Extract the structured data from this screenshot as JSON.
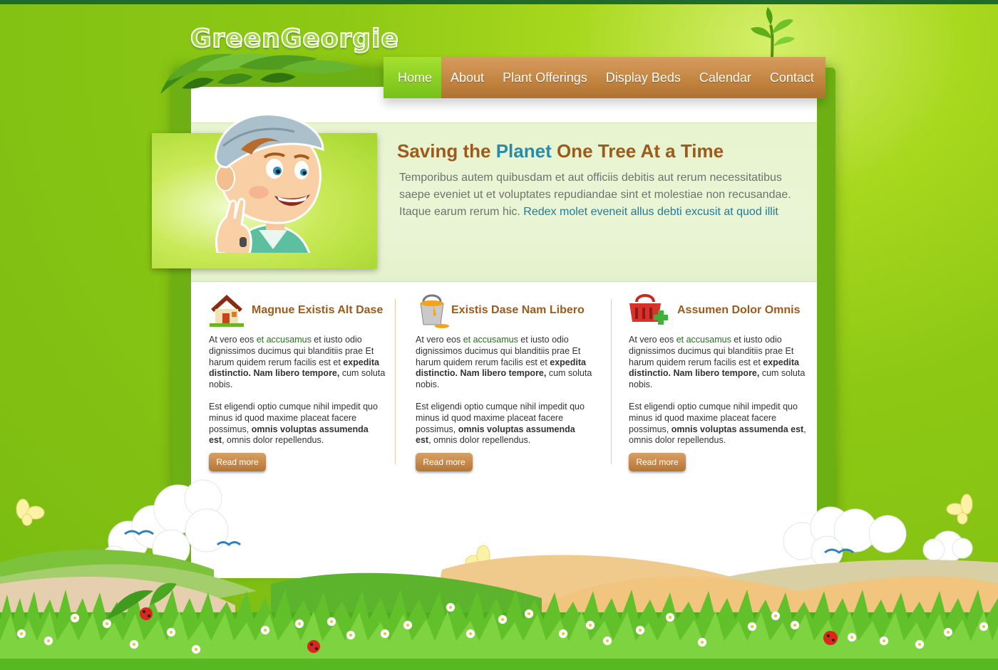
{
  "brand": {
    "logo_text": "GreenGeorgie"
  },
  "nav": {
    "items": [
      {
        "label": "Home",
        "active": true
      },
      {
        "label": "About",
        "active": false
      },
      {
        "label": "Plant Offerings",
        "active": false
      },
      {
        "label": "Display Beds",
        "active": false
      },
      {
        "label": "Calendar",
        "active": false
      },
      {
        "label": "Contact",
        "active": false
      }
    ]
  },
  "hero": {
    "title_pre": "Saving the ",
    "title_highlight": "Planet",
    "title_post": " One Tree At a Time",
    "text": "Temporibus autem quibusdam et aut officiis debitis aut rerum necessitatibus saepe eveniet ut et voluptates repudiandae sint et molestiae non recusandae. Itaque earum rerum hic. ",
    "link_text": "Redex molet eveneit allus debti excusit at quod illit"
  },
  "columns": [
    {
      "title": "Magnue Existis Alt Dase",
      "icon": "house-icon",
      "p1_a": "At vero eos ",
      "p1_link": "et accusamus",
      "p1_b": " et iusto odio dignissimos ducimus qui blanditiis prae Et harum quidem rerum facilis est et ",
      "p1_bold": "expedita distinctio. Nam libero tempore,",
      "p1_c": " cum soluta nobis.",
      "p2_a": "Est eligendi optio cumque nihil impedit quo minus id quod maxime placeat facere possimus, ",
      "p2_bold": "omnis voluptas assumenda est",
      "p2_c": ", omnis dolor repellendus.",
      "button": "Read more"
    },
    {
      "title": "Existis Dase Nam Libero",
      "icon": "paint-bucket-icon",
      "p1_a": "At vero eos ",
      "p1_link": "et accusamus",
      "p1_b": " et iusto odio dignissimos ducimus qui blanditiis prae Et harum quidem rerum facilis est et ",
      "p1_bold": "expedita distinctio. Nam libero tempore,",
      "p1_c": " cum soluta nobis.",
      "p2_a": "Est eligendi optio cumque nihil impedit quo minus id quod maxime placeat facere possimus, ",
      "p2_bold": "omnis voluptas assumenda est",
      "p2_c": ", omnis dolor repellendus.",
      "button": "Read more"
    },
    {
      "title": "Assumen Dolor Omnis",
      "icon": "basket-add-icon",
      "p1_a": "At vero eos ",
      "p1_link": "et accusamus",
      "p1_b": " et iusto odio dignissimos ducimus qui blanditiis prae Et harum quidem rerum facilis est et ",
      "p1_bold": "expedita distinctio. Nam libero tempore,",
      "p1_c": " cum soluta nobis.",
      "p2_a": "Est eligendi optio cumque nihil impedit quo minus id quod maxime placeat facere possimus, ",
      "p2_bold": "omnis voluptas assumenda est",
      "p2_c": ", omnis dolor repellendus.",
      "button": "Read more"
    }
  ],
  "colors": {
    "background_green": "#8dc814",
    "nav_brown": "#c2833f",
    "nav_active_green": "#76c11a",
    "heading_brown": "#9c5a1b",
    "highlight_blue": "#2a8aa8"
  }
}
